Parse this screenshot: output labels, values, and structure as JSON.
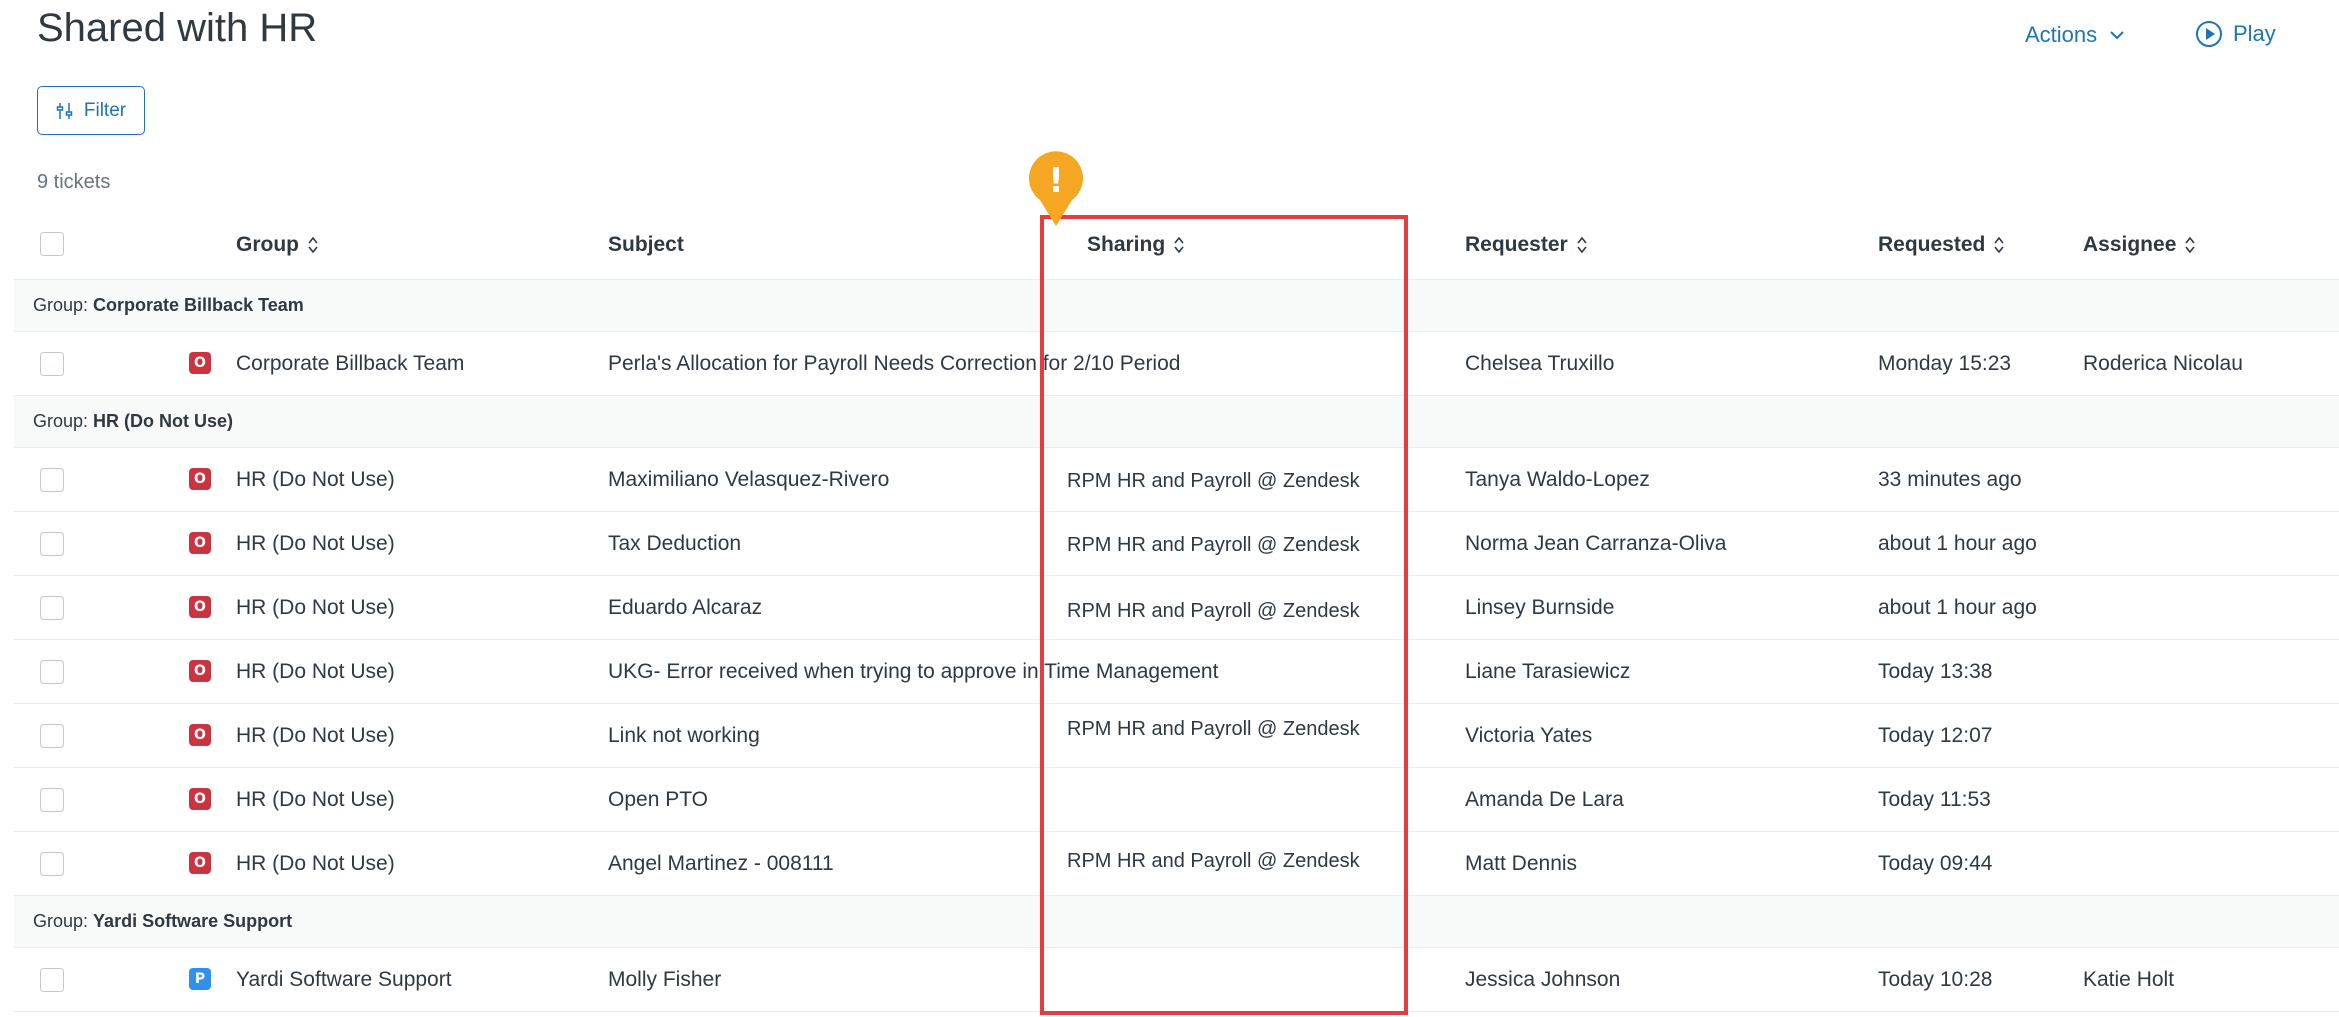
{
  "header": {
    "title": "Shared with HR",
    "actions_label": "Actions",
    "play_label": "Play"
  },
  "toolbar": {
    "filter_label": "Filter",
    "ticket_count": "9 tickets"
  },
  "columns": {
    "group": "Group",
    "subject": "Subject",
    "sharing": "Sharing",
    "requester": "Requester",
    "requested": "Requested",
    "assignee": "Assignee"
  },
  "groups": [
    {
      "prefix": "Group:",
      "name": "Corporate Billback Team"
    },
    {
      "prefix": "Group:",
      "name": "HR (Do Not Use)"
    },
    {
      "prefix": "Group:",
      "name": "Yardi Software Support"
    }
  ],
  "tickets": [
    {
      "status": "O",
      "group": "Corporate Billback Team",
      "subject": "Perla's Allocation for Payroll Needs Correction for 2/10 Period",
      "sharing": "",
      "requester": "Chelsea Truxillo",
      "requested": "Monday 15:23",
      "assignee": "Roderica Nicolau"
    },
    {
      "status": "O",
      "group": "HR (Do Not Use)",
      "subject": "Maximiliano Velasquez-Rivero",
      "sharing": "RPM HR and Payroll @ Zendesk",
      "requester": "Tanya Waldo-Lopez",
      "requested": "33 minutes ago",
      "assignee": ""
    },
    {
      "status": "O",
      "group": "HR (Do Not Use)",
      "subject": "Tax Deduction",
      "sharing": "RPM HR and Payroll @ Zendesk",
      "requester": "Norma Jean Carranza-Oliva",
      "requested": "about 1 hour ago",
      "assignee": ""
    },
    {
      "status": "O",
      "group": "HR (Do Not Use)",
      "subject": "Eduardo Alcaraz",
      "sharing": "RPM HR and Payroll @ Zendesk",
      "requester": "Linsey Burnside",
      "requested": "about 1 hour ago",
      "assignee": ""
    },
    {
      "status": "O",
      "group": "HR (Do Not Use)",
      "subject": "UKG- Error received when trying to approve in Time Management",
      "sharing": "",
      "requester": "Liane Tarasiewicz",
      "requested": "Today 13:38",
      "assignee": ""
    },
    {
      "status": "O",
      "group": "HR (Do Not Use)",
      "subject": "Link not working",
      "sharing": "RPM HR and Payroll @ Zendesk",
      "requester": "Victoria Yates",
      "requested": "Today 12:07",
      "assignee": ""
    },
    {
      "status": "O",
      "group": "HR (Do Not Use)",
      "subject": "Open PTO",
      "sharing": "",
      "requester": "Amanda De Lara",
      "requested": "Today 11:53",
      "assignee": ""
    },
    {
      "status": "O",
      "group": "HR (Do Not Use)",
      "subject": "Angel Martinez - 008111",
      "sharing": "RPM HR and Payroll @ Zendesk",
      "requester": "Matt Dennis",
      "requested": "Today 09:44",
      "assignee": ""
    },
    {
      "status": "P",
      "group": "Yardi Software Support",
      "subject": "Molly Fisher",
      "sharing": "",
      "requester": "Jessica Johnson",
      "requested": "Today 10:28",
      "assignee": "Katie Holt"
    }
  ],
  "status_colors": {
    "O": "#cc3340",
    "P": "#3091ec"
  },
  "annotation": {
    "highlight_color": "#e33d3d",
    "pin_color": "#f5a623",
    "pin_symbol": "!"
  }
}
